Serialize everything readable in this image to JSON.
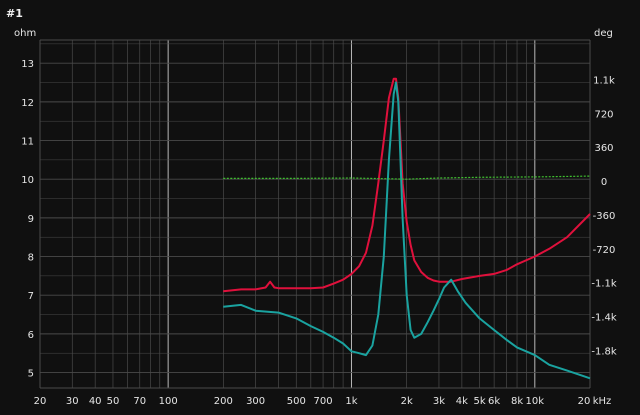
{
  "title": "#1",
  "colors": {
    "background": "#101010",
    "grid_major": "#b8b8b8",
    "grid_minor": "#4a4a4a",
    "impedance": "#e0103c",
    "phase": "#1aa3a0",
    "reference": "#3fbf2f",
    "text": "#e6e6e6"
  },
  "chart_data": {
    "type": "line",
    "title": "#1",
    "y_left_label": "ohm",
    "y_right_label": "deg",
    "x_unit_label": "kHz",
    "x_scale": "log",
    "x_range": [
      20,
      20000
    ],
    "ylim_left": [
      4.6,
      13.6
    ],
    "ylim_right": [
      -2200,
      1500
    ],
    "grid": true,
    "x_ticks": [
      {
        "value": 20,
        "label": "20"
      },
      {
        "value": 30,
        "label": "30"
      },
      {
        "value": 40,
        "label": "40"
      },
      {
        "value": 50,
        "label": "50"
      },
      {
        "value": 70,
        "label": "70"
      },
      {
        "value": 100,
        "label": "100"
      },
      {
        "value": 200,
        "label": "200"
      },
      {
        "value": 300,
        "label": "300"
      },
      {
        "value": 500,
        "label": "500"
      },
      {
        "value": 700,
        "label": "700"
      },
      {
        "value": 1000,
        "label": "1k"
      },
      {
        "value": 2000,
        "label": "2k"
      },
      {
        "value": 3000,
        "label": "3k"
      },
      {
        "value": 4000,
        "label": "4k"
      },
      {
        "value": 5000,
        "label": "5k"
      },
      {
        "value": 6000,
        "label": "6k"
      },
      {
        "value": 8000,
        "label": "8k"
      },
      {
        "value": 10000,
        "label": "10k"
      },
      {
        "value": 20000,
        "label": "20"
      }
    ],
    "y_left_ticks": [
      5,
      6,
      7,
      8,
      9,
      10,
      11,
      12,
      13
    ],
    "y_right_ticks": [
      {
        "value": 1080,
        "label": "1.1k"
      },
      {
        "value": 720,
        "label": "720"
      },
      {
        "value": 360,
        "label": "360"
      },
      {
        "value": 0,
        "label": "0"
      },
      {
        "value": -360,
        "label": "-360"
      },
      {
        "value": -720,
        "label": "-720"
      },
      {
        "value": -1080,
        "label": "-1.1k"
      },
      {
        "value": -1440,
        "label": "-1.4k"
      },
      {
        "value": -1800,
        "label": "-1.8k"
      }
    ],
    "series": [
      {
        "key": "impedance",
        "axis": "left",
        "color": "#e0103c",
        "x": [
          200,
          250,
          300,
          340,
          360,
          380,
          400,
          500,
          600,
          700,
          800,
          900,
          1000,
          1100,
          1200,
          1300,
          1400,
          1500,
          1600,
          1700,
          1750,
          1800,
          1850,
          1900,
          2000,
          2100,
          2200,
          2400,
          2600,
          2800,
          3000,
          3500,
          4000,
          5000,
          6000,
          7000,
          8000,
          10000,
          12000,
          15000,
          20000
        ],
        "y": [
          7.1,
          7.15,
          7.15,
          7.2,
          7.35,
          7.2,
          7.18,
          7.18,
          7.18,
          7.2,
          7.3,
          7.4,
          7.55,
          7.75,
          8.1,
          8.8,
          9.9,
          11.0,
          12.1,
          12.6,
          12.6,
          12.1,
          11.0,
          9.9,
          8.9,
          8.3,
          7.9,
          7.6,
          7.45,
          7.38,
          7.35,
          7.35,
          7.42,
          7.5,
          7.55,
          7.65,
          7.8,
          8.0,
          8.2,
          8.5,
          9.1
        ]
      },
      {
        "key": "phase",
        "axis": "left",
        "color": "#1aa3a0",
        "x": [
          200,
          250,
          300,
          400,
          500,
          600,
          700,
          800,
          900,
          1000,
          1100,
          1200,
          1300,
          1400,
          1500,
          1600,
          1700,
          1750,
          1800,
          1850,
          1900,
          2000,
          2100,
          2200,
          2400,
          2600,
          2800,
          3000,
          3200,
          3500,
          3800,
          4200,
          5000,
          6000,
          7000,
          8000,
          10000,
          12000,
          15000,
          20000
        ],
        "y": [
          6.7,
          6.75,
          6.6,
          6.55,
          6.4,
          6.2,
          6.05,
          5.9,
          5.75,
          5.55,
          5.5,
          5.45,
          5.7,
          6.5,
          8.0,
          10.5,
          12.2,
          12.5,
          12.0,
          10.5,
          9.0,
          7.0,
          6.1,
          5.9,
          6.0,
          6.3,
          6.6,
          6.9,
          7.2,
          7.4,
          7.1,
          6.8,
          6.4,
          6.1,
          5.85,
          5.65,
          5.45,
          5.2,
          5.05,
          4.85
        ]
      },
      {
        "key": "reference",
        "axis": "left",
        "color": "#3fbf2f",
        "dashed": true,
        "x": [
          200,
          500,
          1000,
          2000,
          3000,
          5000,
          10000,
          20000
        ],
        "y": [
          10.02,
          10.02,
          10.03,
          10.0,
          10.03,
          10.05,
          10.06,
          10.08
        ]
      }
    ]
  }
}
